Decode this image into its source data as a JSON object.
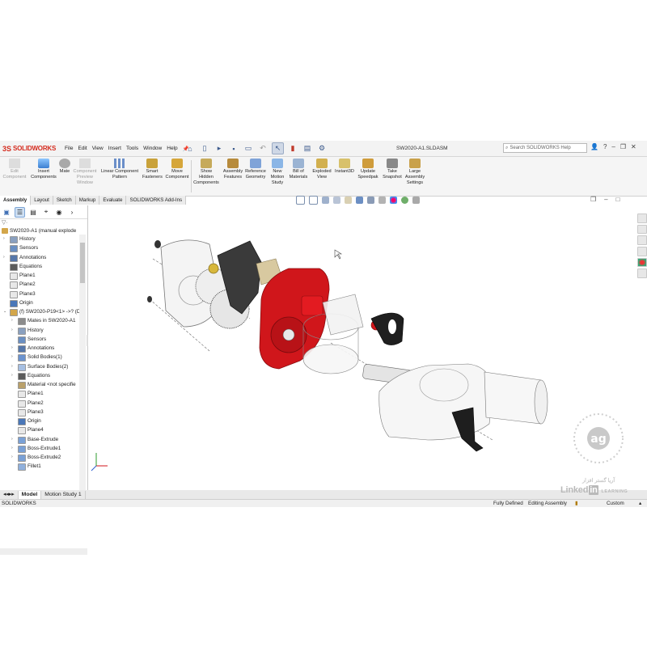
{
  "app": {
    "brand": "SOLIDWORKS",
    "brand_mark": "3S",
    "menus": [
      "File",
      "Edit",
      "View",
      "Insert",
      "Tools",
      "Window",
      "Help"
    ],
    "document_title": "SW2020-A1.SLDASM",
    "search_placeholder": "Search SOLIDWORKS Help"
  },
  "command_manager": {
    "tools": [
      {
        "label": "Edit\nComponent",
        "enabled": false
      },
      {
        "label": "Insert\nComponents",
        "enabled": true
      },
      {
        "label": "Mate",
        "enabled": true
      },
      {
        "label": "Component\nPreview\nWindow",
        "enabled": false
      },
      {
        "label": "Linear Component\nPattern",
        "enabled": true
      },
      {
        "label": "Smart\nFasteners",
        "enabled": true
      },
      {
        "label": "Move\nComponent",
        "enabled": true
      },
      {
        "label": "Show\nHidden\nComponents",
        "enabled": true
      },
      {
        "label": "Assembly\nFeatures",
        "enabled": true
      },
      {
        "label": "Reference\nGeometry",
        "enabled": true
      },
      {
        "label": "New\nMotion\nStudy",
        "enabled": true
      },
      {
        "label": "Bill of\nMaterials",
        "enabled": true
      },
      {
        "label": "Exploded\nView",
        "enabled": true
      },
      {
        "label": "Instant3D",
        "enabled": true
      },
      {
        "label": "Update\nSpeedpak",
        "enabled": true
      },
      {
        "label": "Take\nSnapshot",
        "enabled": true
      },
      {
        "label": "Large\nAssembly\nSettings",
        "enabled": true
      }
    ]
  },
  "tabs": [
    "Assembly",
    "Layout",
    "Sketch",
    "Markup",
    "Evaluate",
    "SOLIDWORKS Add-Ins"
  ],
  "active_tab": "Assembly",
  "feature_tree": {
    "root": "SW2020-A1  (manual explode",
    "items": [
      {
        "label": "History",
        "depth": 1,
        "icon": "history-icon",
        "expand": "›"
      },
      {
        "label": "Sensors",
        "depth": 1,
        "icon": "sensors-icon",
        "expand": ""
      },
      {
        "label": "Annotations",
        "depth": 1,
        "icon": "annotations-icon",
        "expand": "›"
      },
      {
        "label": "Equations",
        "depth": 1,
        "icon": "equations-icon",
        "expand": ""
      },
      {
        "label": "Plane1",
        "depth": 1,
        "icon": "plane-icon",
        "expand": ""
      },
      {
        "label": "Plane2",
        "depth": 1,
        "icon": "plane-icon",
        "expand": ""
      },
      {
        "label": "Plane3",
        "depth": 1,
        "icon": "plane-icon",
        "expand": ""
      },
      {
        "label": "Origin",
        "depth": 1,
        "icon": "origin-icon",
        "expand": ""
      },
      {
        "label": "(f) SW2020-P19<1> ->? (D",
        "depth": 1,
        "icon": "part-icon",
        "expand": "⌄"
      },
      {
        "label": "Mates in SW2020-A1",
        "depth": 2,
        "icon": "mates-icon",
        "expand": "›"
      },
      {
        "label": "History",
        "depth": 2,
        "icon": "history-icon",
        "expand": "›"
      },
      {
        "label": "Sensors",
        "depth": 2,
        "icon": "sensors-icon",
        "expand": ""
      },
      {
        "label": "Annotations",
        "depth": 2,
        "icon": "annotations-icon",
        "expand": "›"
      },
      {
        "label": "Solid Bodies(1)",
        "depth": 2,
        "icon": "solid-bodies-icon",
        "expand": "›"
      },
      {
        "label": "Surface Bodies(2)",
        "depth": 2,
        "icon": "surface-bodies-icon",
        "expand": "›"
      },
      {
        "label": "Equations",
        "depth": 2,
        "icon": "equations-icon",
        "expand": "›"
      },
      {
        "label": "Material <not specifie",
        "depth": 2,
        "icon": "material-icon",
        "expand": ""
      },
      {
        "label": "Plane1",
        "depth": 2,
        "icon": "plane-icon",
        "expand": ""
      },
      {
        "label": "Plane2",
        "depth": 2,
        "icon": "plane-icon",
        "expand": ""
      },
      {
        "label": "Plane3",
        "depth": 2,
        "icon": "plane-icon",
        "expand": ""
      },
      {
        "label": "Origin",
        "depth": 2,
        "icon": "origin-icon",
        "expand": ""
      },
      {
        "label": "Plane4",
        "depth": 2,
        "icon": "plane-icon",
        "expand": ""
      },
      {
        "label": "Base-Extrude",
        "depth": 2,
        "icon": "extrude-icon",
        "expand": "›"
      },
      {
        "label": "Boss-Extrude1",
        "depth": 2,
        "icon": "extrude-icon",
        "expand": "›"
      },
      {
        "label": "Boss-Extrude2",
        "depth": 2,
        "icon": "extrude-icon",
        "expand": "›"
      },
      {
        "label": "Fillet1",
        "depth": 2,
        "icon": "fillet-icon",
        "expand": ""
      }
    ]
  },
  "bottom_tabs": [
    "Model",
    "Motion Study 1"
  ],
  "status": {
    "left": "SOLIDWORKS",
    "defined": "Fully Defined",
    "mode": "Editing Assembly",
    "units": "Custom"
  },
  "watermark": {
    "linkedin": "Linked",
    "linkedin_in": "in",
    "learning": "LEARNING",
    "farsi": "آریا گستر افزار"
  },
  "colors": {
    "brand_red": "#d52b1e",
    "highlight_red": "#d0161b",
    "selection_blue": "#cfe0f3"
  }
}
